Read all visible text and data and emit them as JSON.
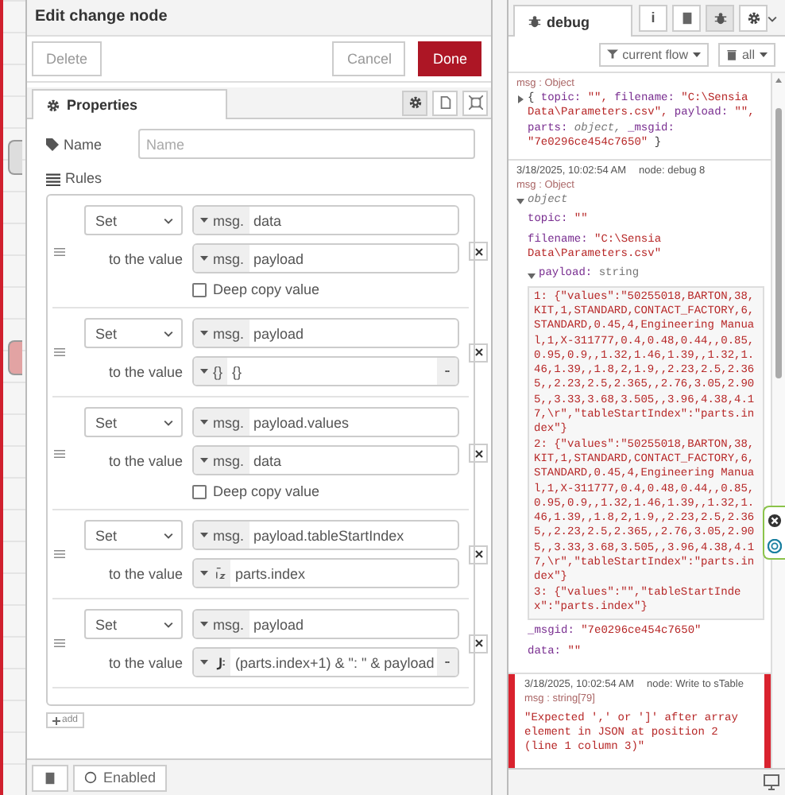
{
  "editor": {
    "title": "Edit change node",
    "buttons": [
      {
        "label": "Delete",
        "kind": "plain"
      },
      {
        "label": "Cancel",
        "kind": "plain"
      },
      {
        "label": "Done",
        "kind": "primary"
      }
    ],
    "tab": {
      "label": "Properties",
      "selected": true
    },
    "name_field": {
      "label": "Name",
      "placeholder": "Name"
    },
    "rules_label": "Rules",
    "rules": [
      {
        "action": "Set",
        "target": {
          "kind": "msg",
          "prefix": "msg.",
          "value": "data"
        },
        "label": "to the value",
        "source": {
          "kind": "msg",
          "prefix": "msg.",
          "value": "payload"
        },
        "deep_copy": {
          "label": "Deep copy value",
          "checked": false
        }
      },
      {
        "action": "Set",
        "target": {
          "kind": "msg",
          "prefix": "msg.",
          "value": "payload"
        },
        "label": "to the value",
        "source": {
          "kind": "json",
          "prefix": "{}",
          "value": "{}"
        }
      },
      {
        "action": "Set",
        "target": {
          "kind": "msg",
          "prefix": "msg.",
          "value": "payload.values"
        },
        "label": "to the value",
        "source": {
          "kind": "msg",
          "prefix": "msg.",
          "value": "data"
        },
        "deep_copy": {
          "label": "Deep copy value",
          "checked": false
        }
      },
      {
        "action": "Set",
        "target": {
          "kind": "msg",
          "prefix": "msg.",
          "value": "payload.tableStartIndex"
        },
        "label": "to the value",
        "source": {
          "kind": "str",
          "value": "parts.index"
        }
      },
      {
        "action": "Set",
        "target": {
          "kind": "msg",
          "prefix": "msg.",
          "value": "payload"
        },
        "label": "to the value",
        "source": {
          "kind": "jsonata",
          "value": "(parts.index+1) & \": \" & payload"
        }
      }
    ],
    "add_button": "add",
    "footer": {
      "enabled_label": "Enabled"
    }
  },
  "debug": {
    "tab": {
      "label": "debug",
      "selected": true
    },
    "side_buttons": [
      {
        "kind": "info",
        "label": "i",
        "selected": false
      },
      {
        "kind": "book",
        "selected": false
      },
      {
        "kind": "bug",
        "selected": true
      },
      {
        "kind": "gear",
        "selected": false
      }
    ],
    "filters": [
      {
        "label": "current flow",
        "kind": "filter"
      },
      {
        "label": "all",
        "kind": "trash"
      }
    ],
    "messages": [
      {
        "kind": "object",
        "meta": "msg : Object",
        "expanded": false,
        "summary": [
          {
            "kind": "plain",
            "text": "{ "
          },
          {
            "kind": "key",
            "text": "topic:"
          },
          {
            "kind": "string",
            "text": " \"\","
          },
          {
            "kind": "key",
            "text": " filename:"
          },
          {
            "kind": "string",
            "text": " \"C:\\Sensia Data\\Parameters.csv\","
          },
          {
            "kind": "key",
            "text": " payload:"
          },
          {
            "kind": "string",
            "text": " \"\","
          },
          {
            "kind": "key",
            "text": " parts:"
          },
          {
            "kind": "type",
            "text": " object,"
          },
          {
            "kind": "key",
            "text": " _msgid:"
          },
          {
            "kind": "string",
            "text": " \"7e0296ce454c7650\""
          },
          {
            "kind": "plain",
            "text": " }"
          }
        ]
      },
      {
        "kind": "object",
        "time": "3/18/2025, 10:02:54 AM",
        "node": "node: debug 8",
        "meta": "msg : Object",
        "expanded": true,
        "root": "object",
        "props": [
          {
            "key": "topic:",
            "value": "\"\""
          },
          {
            "key": "filename:",
            "value": "\"C:\\Sensia Data\\Parameters.csv\""
          },
          {
            "key": "payload:",
            "type": "string",
            "expanded": true,
            "items": [
              "1: {\"values\":\"50255018,BARTON,38,KIT,1,STANDARD,CONTACT_FACTORY,6,STANDARD,0.45,4,Engineering Manual,1,X-311777,0.4,0.48,0.44,,0.85,0.95,0.9,,1.32,1.46,1.39,,1.32,1.46,1.39,,1.8,2,1.9,,2.23,2.5,2.365,,2.23,2.5,2.365,,2.76,3.05,2.905,,3.33,3.68,3.505,,3.96,4.38,4.17,\\r\",\"tableStartIndex\":\"parts.index\"}",
              "2: {\"values\":\"50255018,BARTON,38,KIT,1,STANDARD,CONTACT_FACTORY,6,STANDARD,0.45,4,Engineering Manual,1,X-311777,0.4,0.48,0.44,,0.85,0.95,0.9,,1.32,1.46,1.39,,1.32,1.46,1.39,,1.8,2,1.9,,2.23,2.5,2.365,,2.23,2.5,2.365,,2.76,3.05,2.905,,3.33,3.68,3.505,,3.96,4.38,4.17,\\r\",\"tableStartIndex\":\"parts.index\"}",
              "3: {\"values\":\"\",\"tableStartIndex\":\"parts.index\"}"
            ]
          },
          {
            "key": "_msgid:",
            "value": "\"7e0296ce454c7650\""
          },
          {
            "key": "data:",
            "value": "\"\""
          }
        ]
      },
      {
        "kind": "error",
        "time": "3/18/2025, 10:02:54 AM",
        "node": "node: Write to sTable",
        "meta": "msg : string[79]",
        "text": "\"Expected ',' or ']' after array element in JSON at position 2 (line 1 column 3)\""
      }
    ]
  }
}
